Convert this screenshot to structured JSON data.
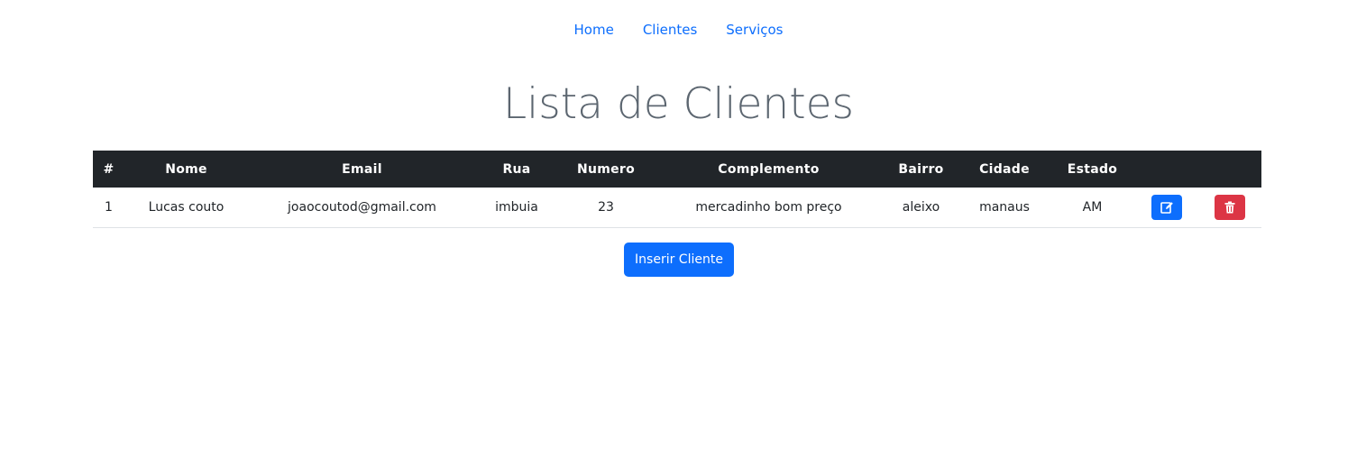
{
  "nav": {
    "items": [
      {
        "label": "Home"
      },
      {
        "label": "Clientes"
      },
      {
        "label": "Serviços"
      }
    ]
  },
  "page_title": "Lista de Clientes",
  "table": {
    "headers": [
      "#",
      "Nome",
      "Email",
      "Rua",
      "Numero",
      "Complemento",
      "Bairro",
      "Cidade",
      "Estado",
      "",
      ""
    ],
    "rows": [
      {
        "id": "1",
        "nome": "Lucas couto",
        "email": "joaocoutod@gmail.com",
        "rua": "imbuia",
        "numero": "23",
        "complemento": "mercadinho bom preço",
        "bairro": "aleixo",
        "cidade": "manaus",
        "estado": "AM",
        "edit_icon": "edit-icon",
        "delete_icon": "trash-icon"
      }
    ]
  },
  "actions": {
    "insert_label": "Inserir Cliente"
  },
  "colors": {
    "primary": "#0d6efd",
    "danger": "#dc3545",
    "header_bg": "#212529",
    "title": "#5c6670"
  }
}
